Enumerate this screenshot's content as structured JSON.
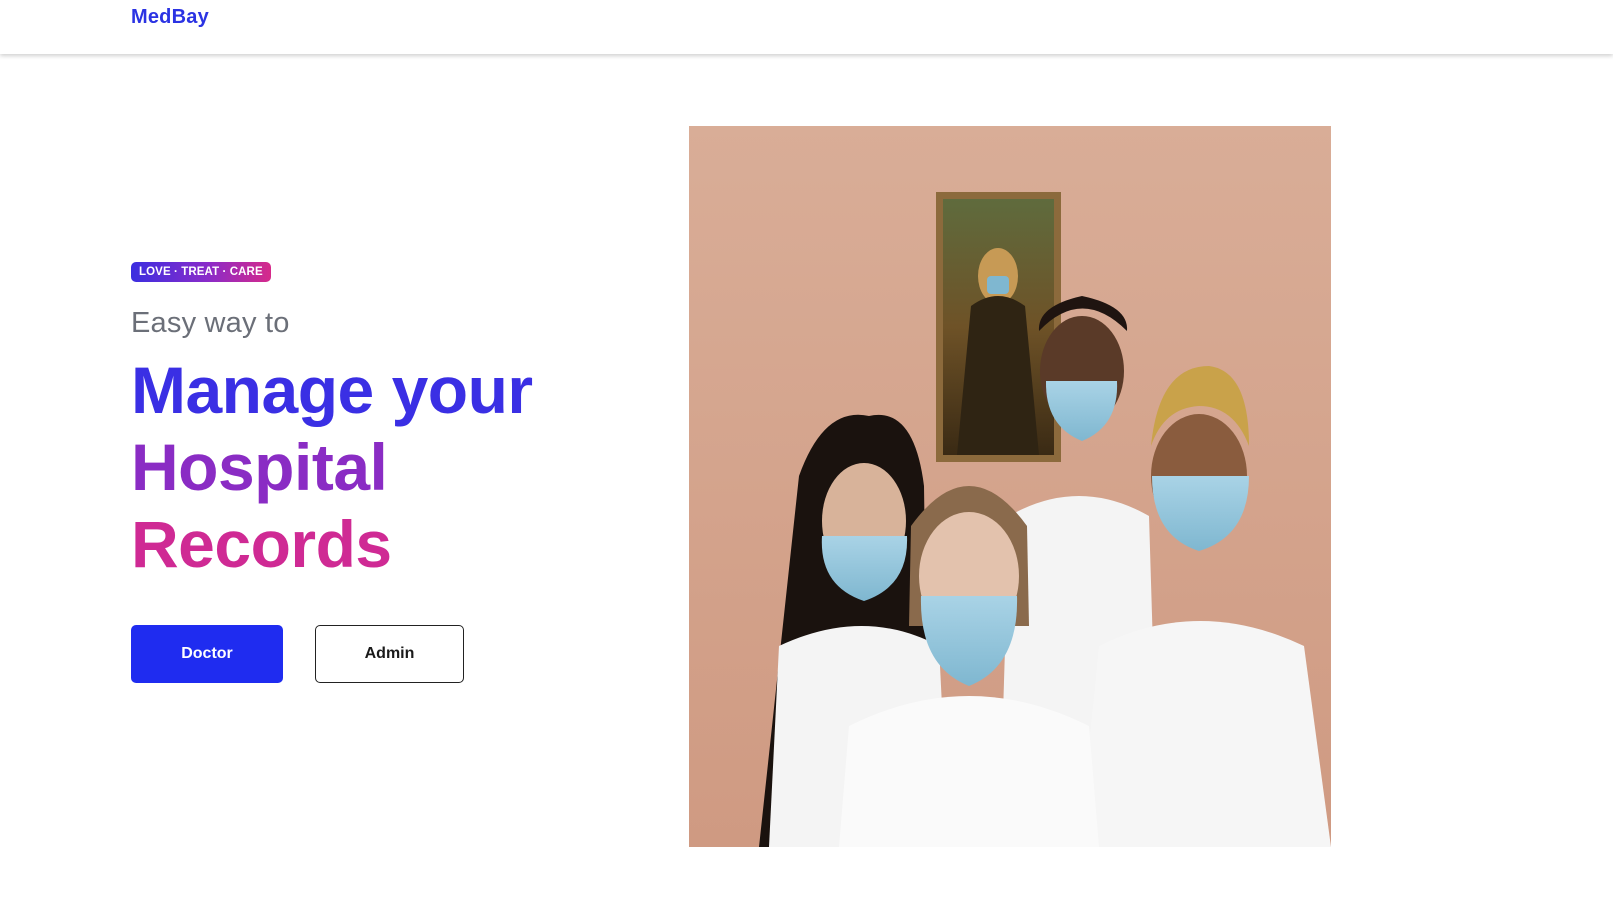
{
  "navbar": {
    "brand": "MedBay"
  },
  "hero": {
    "badge": "LOVE · TREAT · CARE",
    "subtitle": "Easy way to",
    "headline": [
      "Manage your",
      "Hospital",
      "Records"
    ],
    "buttons": {
      "doctor": "Doctor",
      "admin": "Admin"
    }
  },
  "colors": {
    "brand": "#2b33e3",
    "primary_button": "#1f2cf0",
    "headline_gradient": [
      "#3a2fe4",
      "#8a2cc4",
      "#cf2a94"
    ]
  }
}
